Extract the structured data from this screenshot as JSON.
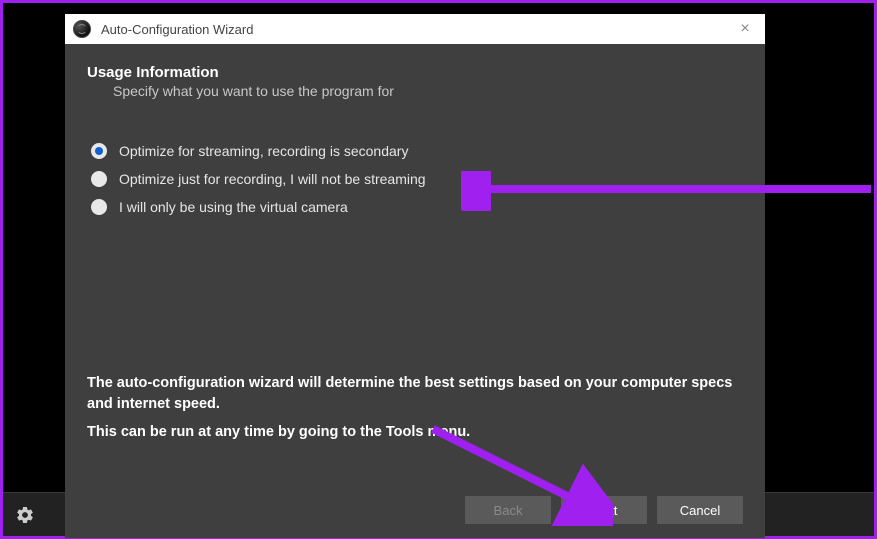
{
  "window": {
    "title": "Auto-Configuration Wizard",
    "close_symbol": "×"
  },
  "header": {
    "title": "Usage Information",
    "subtitle": "Specify what you want to use the program for"
  },
  "options": [
    {
      "label": "Optimize for streaming, recording is secondary",
      "selected": true
    },
    {
      "label": "Optimize just for recording, I will not be streaming",
      "selected": false
    },
    {
      "label": "I will only be using the virtual camera",
      "selected": false
    }
  ],
  "info": {
    "line1": "The auto-configuration wizard will determine the best settings based on your computer specs and internet speed.",
    "line2": "This can be run at any time by going to the Tools menu."
  },
  "buttons": {
    "back": "Back",
    "next": "Next",
    "cancel": "Cancel"
  },
  "toolbar": {
    "settings_icon": "gear-icon"
  },
  "annotations": {
    "arrow_color": "#a020f0",
    "arrow1_target": "option-recording",
    "arrow2_target": "next-button"
  }
}
